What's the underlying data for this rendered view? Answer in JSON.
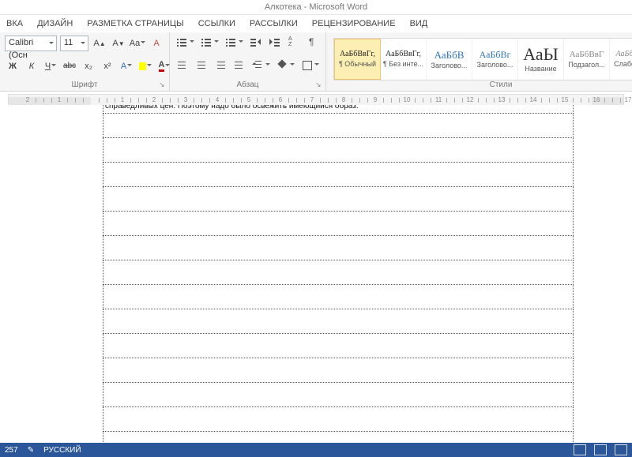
{
  "title": "Алкотека - Microsoft Word",
  "tabs": [
    "ВКА",
    "ДИЗАЙН",
    "РАЗМЕТКА СТРАНИЦЫ",
    "ССЫЛКИ",
    "РАССЫЛКИ",
    "РЕЦЕНЗИРОВАНИЕ",
    "ВИД"
  ],
  "font": {
    "name": "Calibri (Осн",
    "size": "11",
    "grow": "A",
    "shrink": "A",
    "case": "Aa",
    "clear": "A",
    "bold": "Ж",
    "italic": "К",
    "underline": "Ч",
    "strike": "abc",
    "sub": "x₂",
    "sup": "x²",
    "effects": "A",
    "highlight_color": "#ffff00",
    "font_color": "#c00000",
    "group": "Шрифт"
  },
  "para": {
    "group": "Абзац"
  },
  "styles": {
    "group": "Стили",
    "items": [
      {
        "preview": "АаБбВвГг,",
        "name": "¶ Обычный",
        "size": "10px",
        "color": "#222"
      },
      {
        "preview": "АаБбВвГг,",
        "name": "¶ Без инте...",
        "size": "10px",
        "color": "#222"
      },
      {
        "preview": "АаБбВ",
        "name": "Заголово...",
        "size": "13px",
        "color": "#2e74b5"
      },
      {
        "preview": "АаБбВг",
        "name": "Заголово...",
        "size": "12px",
        "color": "#2e74b5"
      },
      {
        "preview": "АаЫ",
        "name": "Название",
        "size": "22px",
        "color": "#333"
      },
      {
        "preview": "АаБбВвГ",
        "name": "Подзагол...",
        "size": "11px",
        "color": "#888"
      },
      {
        "preview": "АаБбВвГг",
        "name": "Слабое в...",
        "size": "10px",
        "color": "#888",
        "italic": true
      }
    ]
  },
  "ruler_numbers": [
    "2",
    "1",
    "1",
    "2",
    "3",
    "4",
    "5",
    "6",
    "7",
    "8",
    "9",
    "10",
    "11",
    "12",
    "13",
    "14",
    "15",
    "16",
    "17"
  ],
  "doc_text_partial": "справедливых цен. Поэтому надо было освежить имеющийся образ.",
  "status": {
    "page": "257",
    "lang": "РУССКИЙ"
  }
}
